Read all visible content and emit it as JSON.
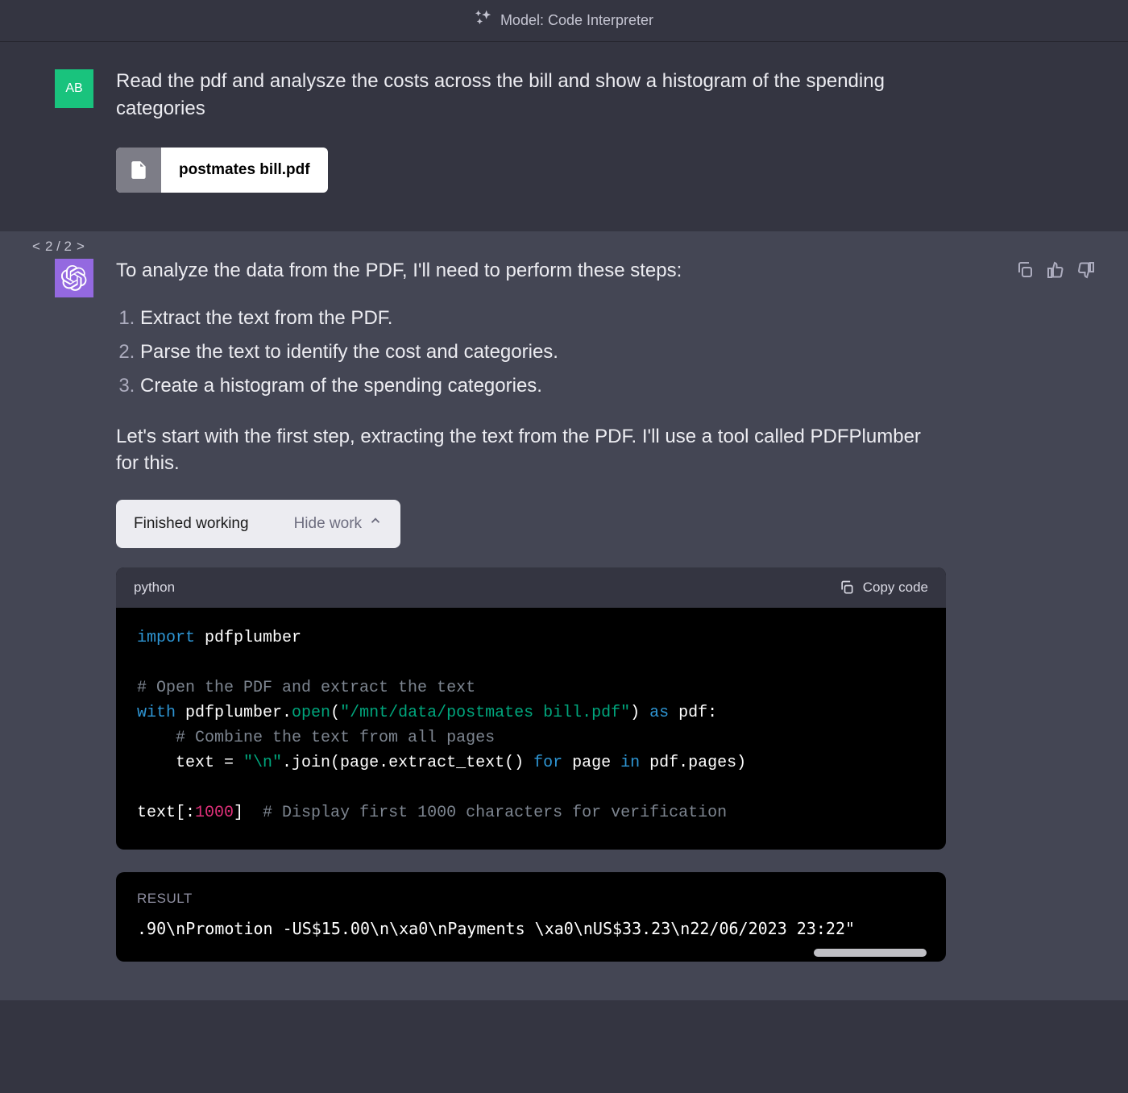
{
  "model_bar": {
    "label": "Model: Code Interpreter"
  },
  "user": {
    "initials": "AB",
    "prompt": "Read the pdf and analysze the costs across the bill and show a histogram of the spending categories",
    "file_name": "postmates bill.pdf"
  },
  "pager": {
    "prev": "<",
    "count": "2 / 2",
    "next": ">"
  },
  "assistant": {
    "intro": "To analyze the data from the PDF, I'll need to perform these steps:",
    "steps": [
      "Extract the text from the PDF.",
      "Parse the text to identify the cost and categories.",
      "Create a histogram of the spending categories."
    ],
    "para": "Let's start with the first step, extracting the text from the PDF. I'll use a tool called PDFPlumber for this.",
    "work_status": "Finished working",
    "hide_work": "Hide work",
    "code_lang": "python",
    "copy_label": "Copy code",
    "code_tokens": {
      "kw_import": "import",
      "mod": " pdfplumber",
      "c1": "# Open the PDF and extract the text",
      "kw_with": "with",
      "open_call_a": " pdfplumber.",
      "open_fn": "open",
      "open_call_b": "(",
      "path": "\"/mnt/data/postmates bill.pdf\"",
      "open_call_c": ") ",
      "kw_as": "as",
      "as_pdf": " pdf:",
      "c2": "    # Combine the text from all pages",
      "join_a": "    text = ",
      "nl": "\"\\n\"",
      "join_b": ".join(page.extract_text() ",
      "kw_for": "for",
      "for_b": " page ",
      "kw_in": "in",
      "in_b": " pdf.pages)",
      "slice_a": "text[:",
      "num1000": "1000",
      "slice_b": "]  ",
      "c3": "# Display first 1000 characters for verification"
    },
    "result_label": "RESULT",
    "result_text": ".90\\nPromotion -US$15.00\\n\\xa0\\nPayments \\xa0\\nUS$33.23\\n22/06/2023 23:22\""
  }
}
